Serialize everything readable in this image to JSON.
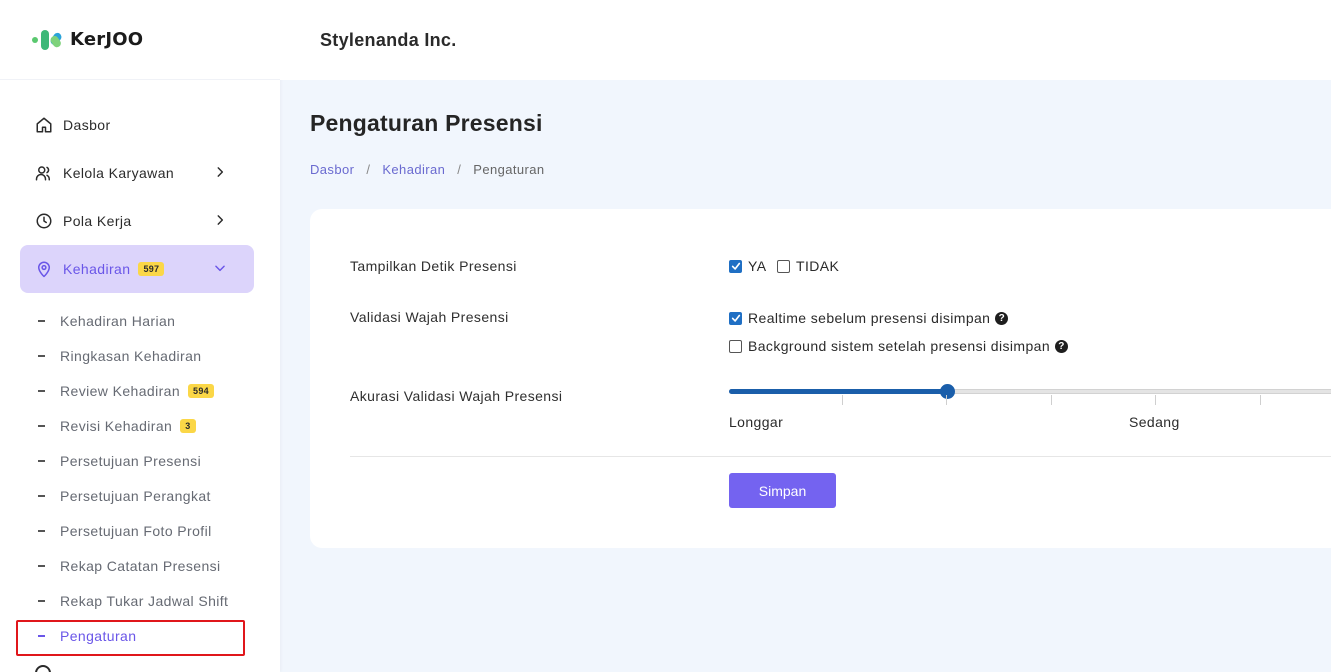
{
  "brand": {
    "logo_text": "KerJOO"
  },
  "header": {
    "company": "Stylenanda Inc."
  },
  "sidebar": {
    "items": [
      {
        "label": "Dasbor",
        "icon": "home-icon"
      },
      {
        "label": "Kelola Karyawan",
        "icon": "users-icon"
      },
      {
        "label": "Pola Kerja",
        "icon": "clock-icon"
      },
      {
        "label": "Kehadiran",
        "icon": "map-pin-icon",
        "badge": "597"
      }
    ],
    "subitems": [
      {
        "label": "Kehadiran Harian"
      },
      {
        "label": "Ringkasan Kehadiran"
      },
      {
        "label": "Review Kehadiran",
        "badge": "594"
      },
      {
        "label": "Revisi Kehadiran",
        "badge": "3"
      },
      {
        "label": "Persetujuan Presensi"
      },
      {
        "label": "Persetujuan Perangkat"
      },
      {
        "label": "Persetujuan Foto Profil"
      },
      {
        "label": "Rekap Catatan Presensi"
      },
      {
        "label": "Rekap Tukar Jadwal Shift"
      },
      {
        "label": "Pengaturan"
      }
    ]
  },
  "page": {
    "title": "Pengaturan Presensi",
    "breadcrumb": [
      "Dasbor",
      "Kehadiran",
      "Pengaturan"
    ],
    "breadcrumb_sep": "/"
  },
  "settings": {
    "detik": {
      "label": "Tampilkan Detik Presensi",
      "options": [
        {
          "label": "YA",
          "checked": true
        },
        {
          "label": "TIDAK",
          "checked": false
        }
      ]
    },
    "validasi": {
      "label": "Validasi Wajah Presensi",
      "options": [
        {
          "label": "Realtime sebelum presensi disimpan",
          "checked": true
        },
        {
          "label": "Background sistem setelah presensi disimpan",
          "checked": false
        }
      ]
    },
    "akurasi": {
      "label": "Akurasi Validasi Wajah Presensi",
      "value_fraction": 0.34,
      "labels": [
        "Longgar",
        "Sedang"
      ]
    },
    "save_label": "Simpan"
  },
  "colors": {
    "accent": "#6a56e8",
    "button": "#7463f0",
    "slider": "#1a5eaa",
    "badge": "#fbd747"
  }
}
